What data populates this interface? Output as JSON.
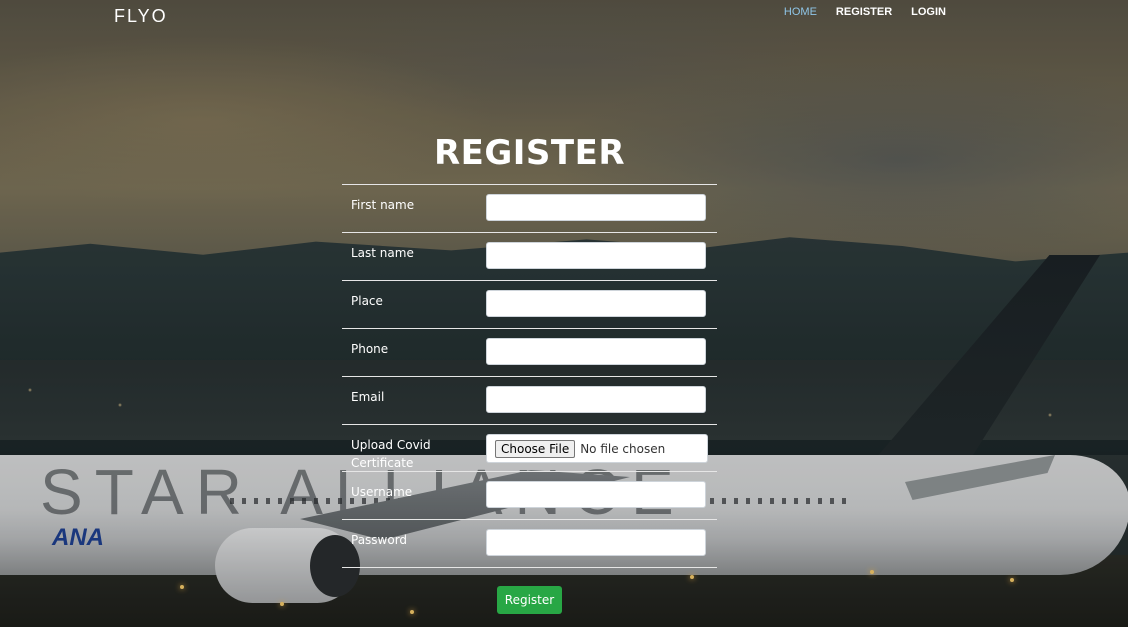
{
  "brand": "FLYO",
  "nav": {
    "home": "HOME",
    "register": "REGISTER",
    "login": "LOGIN"
  },
  "form": {
    "title": "REGISTER",
    "fields": {
      "first_name": {
        "label": "First name",
        "value": ""
      },
      "last_name": {
        "label": "Last name",
        "value": ""
      },
      "place": {
        "label": "Place",
        "value": ""
      },
      "phone": {
        "label": "Phone",
        "value": ""
      },
      "email": {
        "label": "Email",
        "value": ""
      },
      "covid_certificate": {
        "label": "Upload Covid Certificate",
        "button": "Choose File",
        "status": "No file chosen"
      },
      "username": {
        "label": "Username",
        "value": ""
      },
      "password": {
        "label": "Password",
        "value": ""
      }
    },
    "submit_label": "Register"
  },
  "background": {
    "aircraft_livery_text": "STAR ALLIANCE",
    "airline_text": "ANA"
  },
  "colors": {
    "accent_active_nav": "#8fc6e8",
    "submit_button": "#28a745"
  }
}
